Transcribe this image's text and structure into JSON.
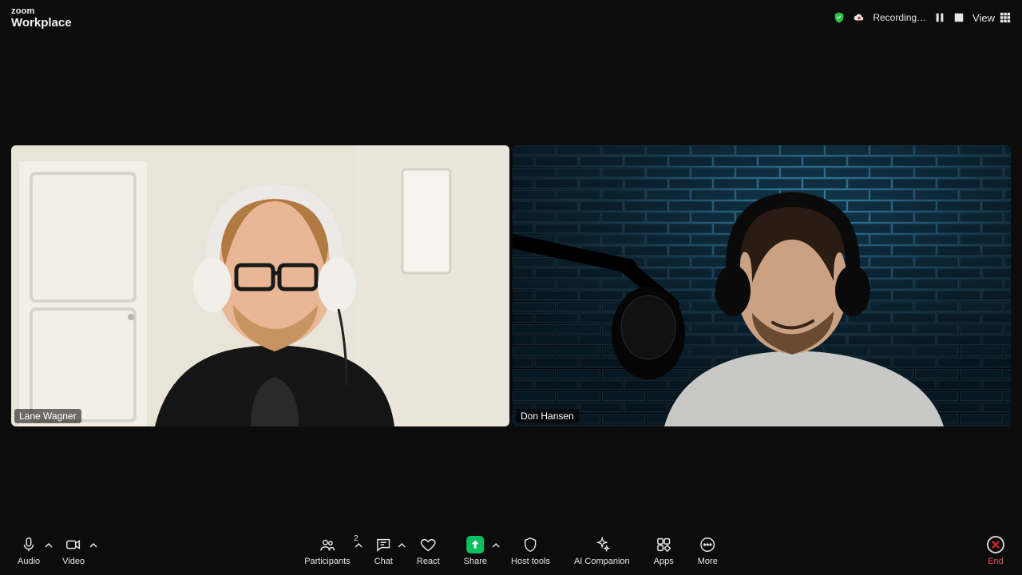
{
  "brand": {
    "top": "zoom",
    "sub": "Workplace"
  },
  "top": {
    "recording": "Recording…",
    "view": "View"
  },
  "participants": [
    {
      "name": "Lane Wagner"
    },
    {
      "name": "Don Hansen"
    }
  ],
  "toolbar": {
    "audio": "Audio",
    "video": "Video",
    "participants": "Participants",
    "participants_count": "2",
    "chat": "Chat",
    "react": "React",
    "share": "Share",
    "host_tools": "Host tools",
    "ai_companion": "AI Companion",
    "apps": "Apps",
    "more": "More",
    "end": "End"
  }
}
